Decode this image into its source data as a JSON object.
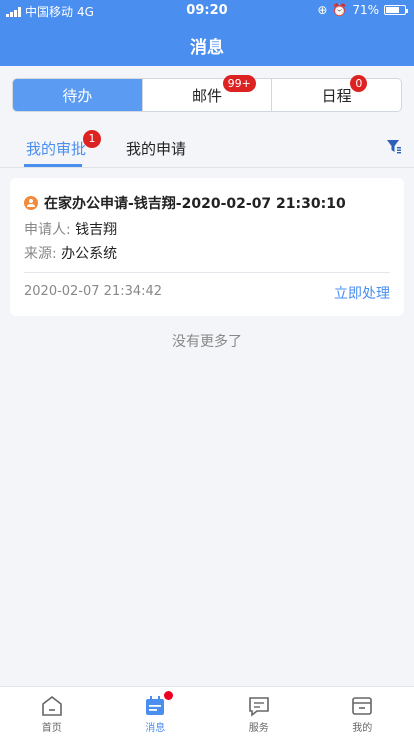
{
  "status_bar": {
    "carrier": "中国移动",
    "network": "4G",
    "time": "09:20",
    "battery_pct": "71%",
    "battery_level": 0.71
  },
  "header": {
    "title": "消息"
  },
  "segments": [
    {
      "label": "待办",
      "badge": ""
    },
    {
      "label": "邮件",
      "badge": "99+"
    },
    {
      "label": "日程",
      "badge": "0"
    }
  ],
  "subtabs": [
    {
      "label": "我的审批",
      "badge": "1"
    },
    {
      "label": "我的申请",
      "badge": ""
    }
  ],
  "card": {
    "title": "在家办公申请-钱吉翔-2020-02-07 21:30:10",
    "applicant_key": "申请人:",
    "applicant_value": "钱吉翔",
    "source_key": "来源:",
    "source_value": "办公系统",
    "time": "2020-02-07 21:34:42",
    "action": "立即处理"
  },
  "no_more": "没有更多了",
  "tabbar": [
    {
      "label": "首页",
      "icon": "home-icon"
    },
    {
      "label": "消息",
      "icon": "message-calendar-icon"
    },
    {
      "label": "服务",
      "icon": "chat-service-icon"
    },
    {
      "label": "我的",
      "icon": "wallet-icon"
    }
  ],
  "colors": {
    "primary": "#4a8ef0",
    "badge": "#dd2222",
    "accent_orange": "#f08a3c"
  }
}
